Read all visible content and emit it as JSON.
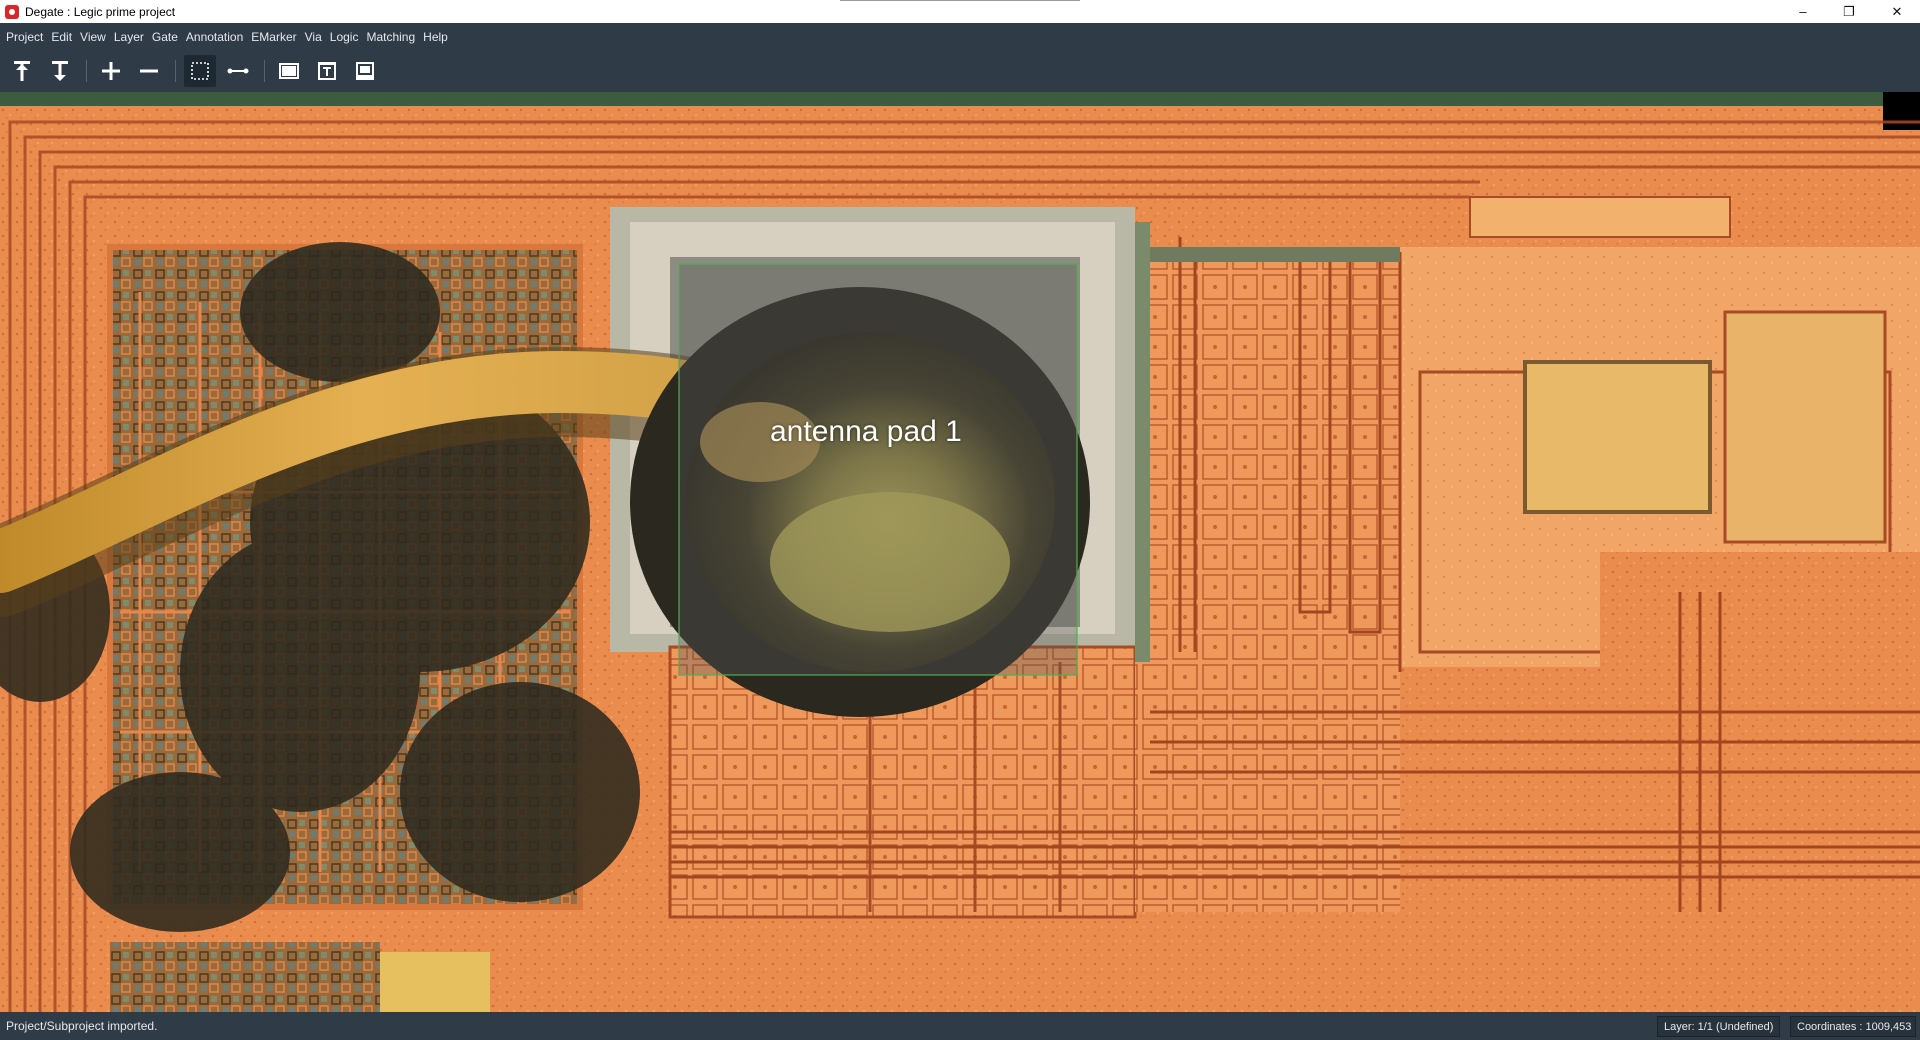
{
  "window": {
    "title": "Degate : Legic prime project",
    "minimize_glyph": "–",
    "maximize_glyph": "❐",
    "close_glyph": "✕"
  },
  "menu": {
    "items": [
      "Project",
      "Edit",
      "View",
      "Layer",
      "Gate",
      "Annotation",
      "EMarker",
      "Via",
      "Logic",
      "Matching",
      "Help"
    ]
  },
  "toolbar": {
    "buttons": [
      "layer-up-icon",
      "layer-down-icon",
      "zoom-in-icon",
      "zoom-out-icon",
      "area-select-icon",
      "wire-tool-icon",
      "workspace-icon",
      "gate-template-icon",
      "gate-library-icon"
    ],
    "active": "area-select-icon"
  },
  "annotation": {
    "label": "antenna pad 1"
  },
  "status": {
    "message": "Project/Subproject imported.",
    "layer": "Layer: 1/1 (Undefined)",
    "coordinates": "Coordinates : 1009,453"
  },
  "colors": {
    "chrome": "#2f3b47",
    "die_orange": "#e8884a",
    "annotation_border": "#4caf50"
  }
}
